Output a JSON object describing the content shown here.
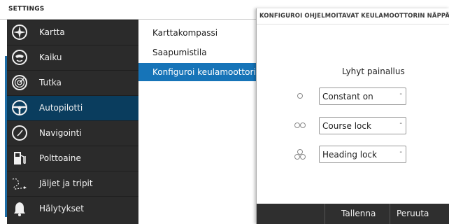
{
  "header": {
    "title": "SETTINGS"
  },
  "sidebar": {
    "items": [
      {
        "label": "Kartta",
        "icon": "chart-compass-icon",
        "selected": false
      },
      {
        "label": "Kaiku",
        "icon": "echo-sounder-icon",
        "selected": false
      },
      {
        "label": "Tutka",
        "icon": "radar-icon",
        "selected": false
      },
      {
        "label": "Autopilotti",
        "icon": "steering-wheel-icon",
        "selected": true
      },
      {
        "label": "Navigointi",
        "icon": "navigation-compass-icon",
        "selected": false
      },
      {
        "label": "Polttoaine",
        "icon": "fuel-pump-icon",
        "selected": false
      },
      {
        "label": "Jäljet ja tripit",
        "icon": "trail-icon",
        "selected": false
      },
      {
        "label": "Hälytykset",
        "icon": "alarm-bell-icon",
        "selected": false
      }
    ]
  },
  "middle": {
    "items": [
      {
        "label": "Karttakompassi"
      },
      {
        "label": "Saapumistila"
      },
      {
        "label": "Konfiguroi keulamoottorin näppäimet",
        "highlight": true
      }
    ]
  },
  "dialog": {
    "title": "KONFIGUROI OHJELMOITAVAT KEULAMOOTTORIN NÄPPÄIMET",
    "column_header": "Lyhyt painallus",
    "rows": [
      {
        "icon": "single-circle-icon",
        "value": "Constant on"
      },
      {
        "icon": "double-circle-icon",
        "value": "Course lock"
      },
      {
        "icon": "triple-circle-icon",
        "value": "Heading lock"
      }
    ],
    "footer": {
      "save_label": "Tallenna",
      "cancel_label": "Peruuta"
    }
  },
  "colors": {
    "sidebar_bg": "#2b2b2b",
    "sidebar_selected": "#0a3d5e",
    "highlight": "#1674b8",
    "footer_bg": "#2f2f2f"
  }
}
